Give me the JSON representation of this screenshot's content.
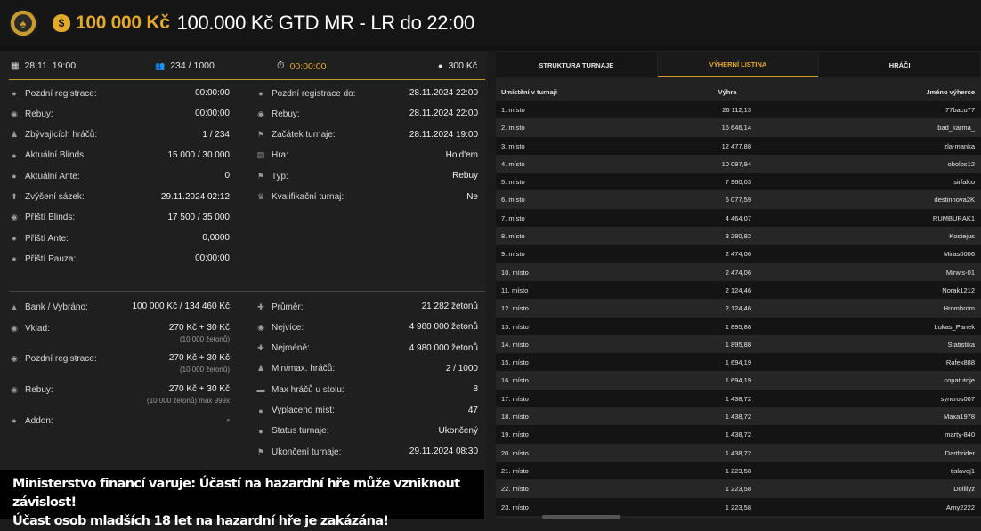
{
  "header": {
    "logo_icon": "casino-chip-logo",
    "prize_amount": "100 000 Kč",
    "title": "100.000 Kč GTD MR - LR do 22:00"
  },
  "summary": {
    "date": "28.11. 19:00",
    "players": "234 / 1000",
    "timer": "00:00:00",
    "buyin": "300 Kč"
  },
  "left_col": [
    {
      "icon": "user-icon",
      "label": "Pozdní registrace:",
      "value": "00:00:00"
    },
    {
      "icon": "money-icon",
      "label": "Rebuy:",
      "value": "00:00:00"
    },
    {
      "icon": "users-icon",
      "label": "Zbývajících hráčů:",
      "value": "1 / 234"
    },
    {
      "icon": "clock-icon",
      "label": "Aktuální Blinds:",
      "value": "15 000 / 30 000"
    },
    {
      "icon": "clock-icon",
      "label": "Aktuální Ante:",
      "value": "0"
    },
    {
      "icon": "arrow-up-icon",
      "label": "Zvýšení sázek:",
      "value": "29.11.2024 02:12"
    },
    {
      "icon": "money-icon",
      "label": "Příští Blinds:",
      "value": "17 500 / 35 000"
    },
    {
      "icon": "clock-icon",
      "label": "Příští Ante:",
      "value": "0,0000"
    },
    {
      "icon": "clock-icon",
      "label": "Příští Pauza:",
      "value": "00:00:00"
    }
  ],
  "right_col": [
    {
      "icon": "user-icon",
      "label": "Pozdní registrace do:",
      "value": "28.11.2024 22:00"
    },
    {
      "icon": "money-icon",
      "label": "Rebuy:",
      "value": "28.11.2024 22:00"
    },
    {
      "icon": "flag-icon",
      "label": "Začátek turnaje:",
      "value": "28.11.2024 19:00"
    },
    {
      "icon": "cards-icon",
      "label": "Hra:",
      "value": "Hold'em"
    },
    {
      "icon": "flag-icon",
      "label": "Typ:",
      "value": "Rebuy"
    },
    {
      "icon": "trophy-icon",
      "label": "Kvalifikační turnaj:",
      "value": "Ne"
    }
  ],
  "bottom_left": {
    "bank_label": "Bank / Vybráno:",
    "bank_value": "100 000 Kč / 134 460 Kč",
    "vklad_label": "Vklad:",
    "vklad_value": "270 Kč + 30 Kč",
    "vklad_sub": "(10 000 žetonů)",
    "late_label": "Pozdní registrace:",
    "late_value": "270 Kč + 30 Kč",
    "late_sub": "(10 000 žetonů)",
    "rebuy_label": "Rebuy:",
    "rebuy_value": "270 Kč + 30 Kč",
    "rebuy_sub": "(10 000 žetonů) max 999x",
    "addon_label": "Addon:",
    "addon_value": "-"
  },
  "bottom_right": [
    {
      "icon": "plus-icon",
      "label": "Průměr:",
      "value": "21 282 žetonů"
    },
    {
      "icon": "money-icon",
      "label": "Nejvíce:",
      "value": "4 980 000 žetonů"
    },
    {
      "icon": "plus-icon",
      "label": "Nejméně:",
      "value": "4 980 000 žetonů"
    },
    {
      "icon": "users-icon",
      "label": "Min/max. hráčů:",
      "value": "2 / 1000"
    },
    {
      "icon": "table-icon",
      "label": "Max hráčů u stolu:",
      "value": "8"
    },
    {
      "icon": "bag-icon",
      "label": "Vyplaceno míst:",
      "value": "47"
    },
    {
      "icon": "clock-icon",
      "label": "Status turnaje:",
      "value": "Ukončený"
    },
    {
      "icon": "flag-icon",
      "label": "Ukončení turnaje:",
      "value": "29.11.2024 08:30"
    }
  ],
  "warning": {
    "line1": "Ministerstvo financí varuje: Účastí na hazardní hře může vzniknout závislost!",
    "line2": "Účast osob mladších 18 let na hazardní hře je zakázána!"
  },
  "tabs": [
    "Struktura turnaje",
    "Výherní listina",
    "Hráči"
  ],
  "table_headers": {
    "place": "Umístění v turnaji",
    "win": "Výhra",
    "name": "Jméno výherce"
  },
  "results": [
    {
      "place": "1. místo",
      "win": "26 112,13",
      "name": "77bacu77"
    },
    {
      "place": "2. místo",
      "win": "16 646,14",
      "name": "bad_karma_"
    },
    {
      "place": "3. místo",
      "win": "12 477,88",
      "name": "zla-manka"
    },
    {
      "place": "4. místo",
      "win": "10 097,94",
      "name": "obolos12"
    },
    {
      "place": "5. místo",
      "win": "7 960,03",
      "name": "sirfalco"
    },
    {
      "place": "6. místo",
      "win": "6 077,59",
      "name": "destinnova2K"
    },
    {
      "place": "7. místo",
      "win": "4 464,07",
      "name": "RUMBURAK1"
    },
    {
      "place": "8. místo",
      "win": "3 280,82",
      "name": "Kostejus"
    },
    {
      "place": "9. místo",
      "win": "2 474,06",
      "name": "Miras0006"
    },
    {
      "place": "10. místo",
      "win": "2 474,06",
      "name": "Mirwis-01"
    },
    {
      "place": "11. místo",
      "win": "2 124,46",
      "name": "Norak1212"
    },
    {
      "place": "12. místo",
      "win": "2 124,46",
      "name": "Hromhrom"
    },
    {
      "place": "13. místo",
      "win": "1 895,88",
      "name": "Lukas_Panek"
    },
    {
      "place": "14. místo",
      "win": "1 895,88",
      "name": "Statistika"
    },
    {
      "place": "15. místo",
      "win": "1 694,19",
      "name": "Rafek888"
    },
    {
      "place": "16. místo",
      "win": "1 694,19",
      "name": "copatutoje"
    },
    {
      "place": "17. místo",
      "win": "1 438,72",
      "name": "syncros007"
    },
    {
      "place": "18. místo",
      "win": "1 438,72",
      "name": "Maxa1978"
    },
    {
      "place": "19. místo",
      "win": "1 438,72",
      "name": "marty-840"
    },
    {
      "place": "20. místo",
      "win": "1 438,72",
      "name": "Darthrider"
    },
    {
      "place": "21. místo",
      "win": "1 223,58",
      "name": "tjslavoj1"
    },
    {
      "place": "22. místo",
      "win": "1 223,58",
      "name": "Dollllyz"
    },
    {
      "place": "23. místo",
      "win": "1 223,58",
      "name": "Arny2222"
    }
  ]
}
